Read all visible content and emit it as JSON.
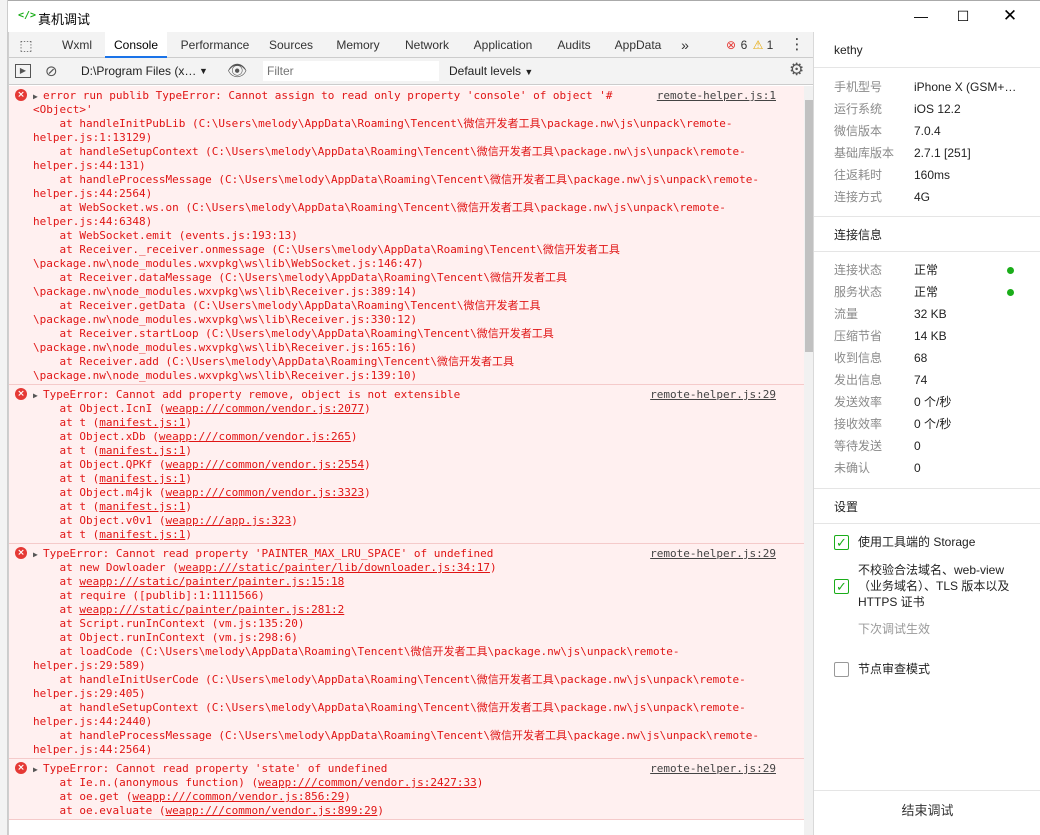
{
  "window": {
    "title": "真机调试"
  },
  "tabs": [
    "Wxml",
    "Console",
    "Performance",
    "Sources",
    "Memory",
    "Network",
    "Application",
    "Audits",
    "AppData"
  ],
  "tab_counts": {
    "errors": "6",
    "warnings": "1"
  },
  "toolbar": {
    "context": "D:\\Program Files (x…",
    "filter_placeholder": "Filter",
    "levels": "Default levels"
  },
  "messages": [
    {
      "source": "remote-helper.js:1",
      "lines": [
        "error run publib TypeError: Cannot assign to read only property 'console' of object '#",
        "<Object>'",
        "    at handleInitPubLib (C:\\Users\\melody\\AppData\\Roaming\\Tencent\\微信开发者工具\\package.nw\\js\\unpack\\remote-",
        "helper.js:1:13129)",
        "    at handleSetupContext (C:\\Users\\melody\\AppData\\Roaming\\Tencent\\微信开发者工具\\package.nw\\js\\unpack\\remote-",
        "helper.js:44:131)",
        "    at handleProcessMessage (C:\\Users\\melody\\AppData\\Roaming\\Tencent\\微信开发者工具\\package.nw\\js\\unpack\\remote-",
        "helper.js:44:2564)",
        "    at WebSocket.ws.on (C:\\Users\\melody\\AppData\\Roaming\\Tencent\\微信开发者工具\\package.nw\\js\\unpack\\remote-",
        "helper.js:44:6348)",
        "    at WebSocket.emit (events.js:193:13)",
        "    at Receiver._receiver.onmessage (C:\\Users\\melody\\AppData\\Roaming\\Tencent\\微信开发者工具",
        "\\package.nw\\node_modules.wxvpkg\\ws\\lib\\WebSocket.js:146:47)",
        "    at Receiver.dataMessage (C:\\Users\\melody\\AppData\\Roaming\\Tencent\\微信开发者工具",
        "\\package.nw\\node_modules.wxvpkg\\ws\\lib\\Receiver.js:389:14)",
        "    at Receiver.getData (C:\\Users\\melody\\AppData\\Roaming\\Tencent\\微信开发者工具",
        "\\package.nw\\node_modules.wxvpkg\\ws\\lib\\Receiver.js:330:12)",
        "    at Receiver.startLoop (C:\\Users\\melody\\AppData\\Roaming\\Tencent\\微信开发者工具",
        "\\package.nw\\node_modules.wxvpkg\\ws\\lib\\Receiver.js:165:16)",
        "    at Receiver.add (C:\\Users\\melody\\AppData\\Roaming\\Tencent\\微信开发者工具",
        "\\package.nw\\node_modules.wxvpkg\\ws\\lib\\Receiver.js:139:10)"
      ]
    },
    {
      "source": "remote-helper.js:29",
      "lines": [
        "TypeError: Cannot add property remove, object is not extensible",
        "    at Object.IcnI (weapp:///common/vendor.js:2077)",
        "    at t (manifest.js:1)",
        "    at Object.xDb (weapp:///common/vendor.js:265)",
        "    at t (manifest.js:1)",
        "    at Object.QPKf (weapp:///common/vendor.js:2554)",
        "    at t (manifest.js:1)",
        "    at Object.m4jk (weapp:///common/vendor.js:3323)",
        "    at t (manifest.js:1)",
        "    at Object.v0v1 (weapp:///app.js:323)",
        "    at t (manifest.js:1)"
      ]
    },
    {
      "source": "remote-helper.js:29",
      "lines": [
        "TypeError: Cannot read property 'PAINTER_MAX_LRU_SPACE' of undefined",
        "    at new Dowloader (weapp:///static/painter/lib/downloader.js:34:17)",
        "    at weapp:///static/painter/painter.js:15:18",
        "    at require ([publib]:1:1111566)",
        "    at weapp:///static/painter/painter.js:281:2",
        "    at Script.runInContext (vm.js:135:20)",
        "    at Object.runInContext (vm.js:298:6)",
        "    at loadCode (C:\\Users\\melody\\AppData\\Roaming\\Tencent\\微信开发者工具\\package.nw\\js\\unpack\\remote-",
        "helper.js:29:589)",
        "    at handleInitUserCode (C:\\Users\\melody\\AppData\\Roaming\\Tencent\\微信开发者工具\\package.nw\\js\\unpack\\remote-",
        "helper.js:29:405)",
        "    at handleSetupContext (C:\\Users\\melody\\AppData\\Roaming\\Tencent\\微信开发者工具\\package.nw\\js\\unpack\\remote-",
        "helper.js:44:2440)",
        "    at handleProcessMessage (C:\\Users\\melody\\AppData\\Roaming\\Tencent\\微信开发者工具\\package.nw\\js\\unpack\\remote-",
        "helper.js:44:2564)"
      ]
    },
    {
      "source": "remote-helper.js:29",
      "lines": [
        "TypeError: Cannot read property 'state' of undefined",
        "    at Ie.n.(anonymous function) (weapp:///common/vendor.js:2427:33)",
        "    at oe.get (weapp:///common/vendor.js:856:29)",
        "    at oe.evaluate (weapp:///common/vendor.js:899:29)"
      ]
    }
  ],
  "panel": {
    "user": "kethy",
    "device": [
      {
        "k": "手机型号",
        "v": "iPhone X (GSM+…"
      },
      {
        "k": "运行系统",
        "v": "iOS 12.2"
      },
      {
        "k": "微信版本",
        "v": "7.0.4"
      },
      {
        "k": "基础库版本",
        "v": "2.7.1 [251]"
      },
      {
        "k": "往返耗时",
        "v": "160ms"
      },
      {
        "k": "连接方式",
        "v": "4G"
      }
    ],
    "conn_header": "连接信息",
    "conn": [
      {
        "k": "连接状态",
        "v": "正常"
      },
      {
        "k": "服务状态",
        "v": "正常"
      },
      {
        "k": "流量",
        "v": "32 KB"
      },
      {
        "k": "压缩节省",
        "v": "14 KB"
      },
      {
        "k": "收到信息",
        "v": "68"
      },
      {
        "k": "发出信息",
        "v": "74"
      },
      {
        "k": "发送效率",
        "v": "0 个/秒"
      },
      {
        "k": "接收效率",
        "v": "0 个/秒"
      },
      {
        "k": "等待发送",
        "v": "0"
      },
      {
        "k": "未确认",
        "v": "0"
      }
    ],
    "settings_header": "设置",
    "setting1": "使用工具端的 Storage",
    "setting2": "不校验合法域名、web-view（业务域名）、TLS 版本以及 HTTPS 证书",
    "setting2_hint": "下次调试生效",
    "setting3": "节点审查模式",
    "end_button": "结束调试"
  }
}
